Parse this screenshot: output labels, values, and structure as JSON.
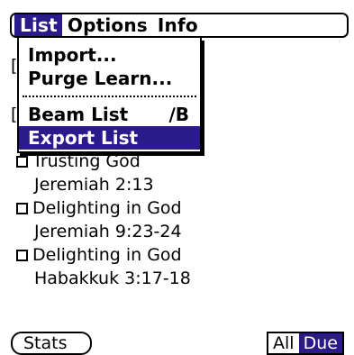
{
  "menubar": {
    "menus": [
      "List",
      "Options",
      "Info"
    ]
  },
  "dropdown": {
    "items": [
      {
        "label": "Import..."
      },
      {
        "label": "Purge Learn..."
      },
      {
        "label": "Beam List",
        "shortcut": "∕B"
      },
      {
        "label": "Export List"
      }
    ]
  },
  "list": {
    "entries": [
      {
        "title": "Trusting God",
        "ref": "Jeremiah 2:13"
      },
      {
        "title": "Delighting in God",
        "ref": "Jeremiah 9:23-24"
      },
      {
        "title": "Delighting in God",
        "ref": "Habakkuk 3:17-18"
      }
    ]
  },
  "footer": {
    "stats_label": "Stats",
    "filter_options": [
      "All",
      "Due"
    ],
    "selected_filter": "Due"
  }
}
